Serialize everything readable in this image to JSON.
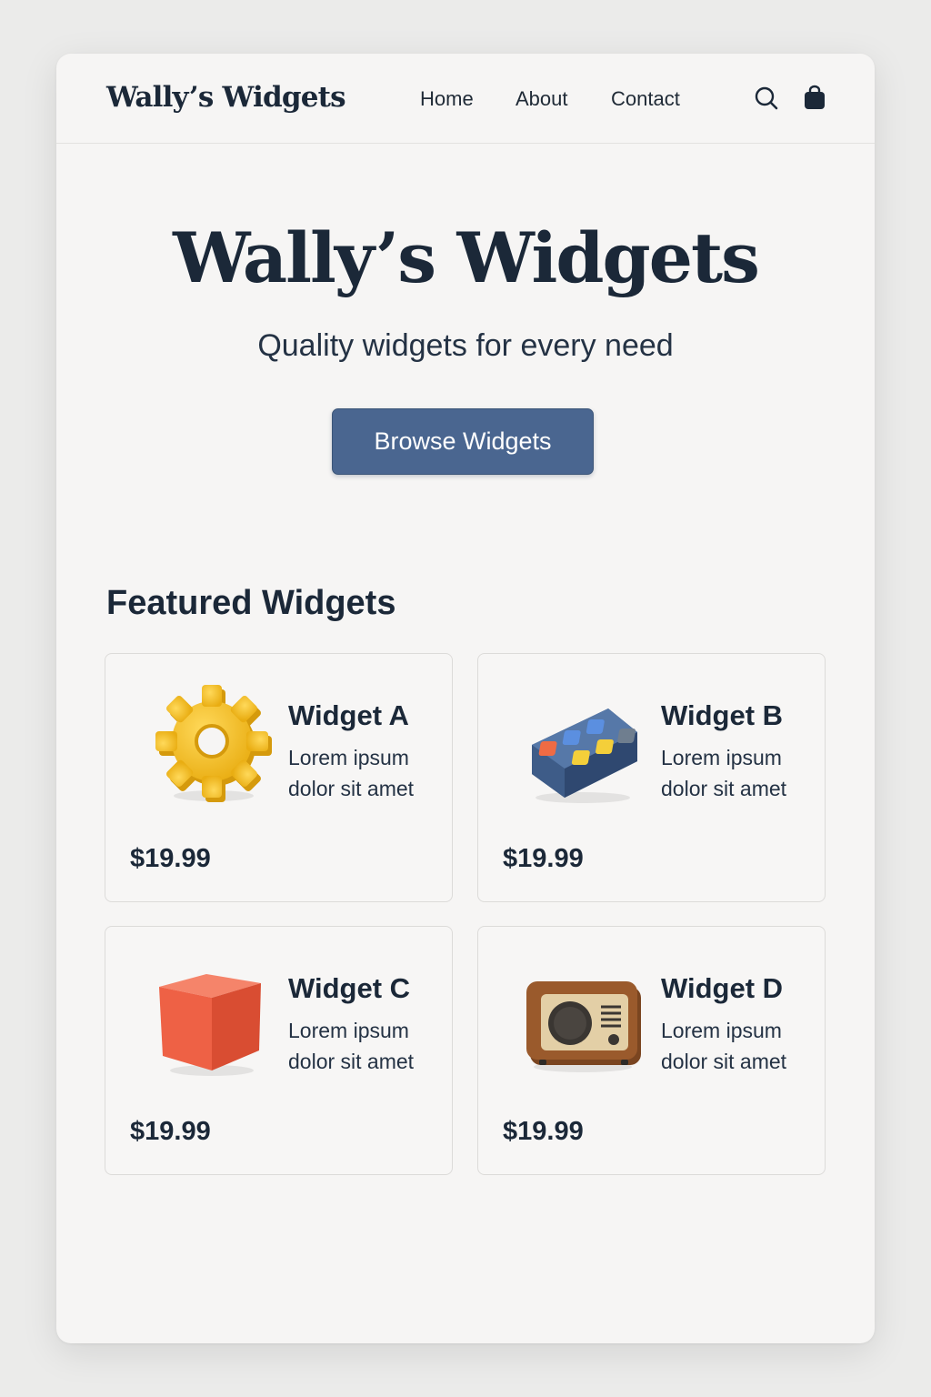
{
  "header": {
    "brand": "Wally’s Widgets",
    "nav": [
      {
        "label": "Home"
      },
      {
        "label": "About"
      },
      {
        "label": "Contact"
      }
    ],
    "icons": [
      "search-icon",
      "shopping-bag-icon"
    ]
  },
  "hero": {
    "title": "Wally’s Widgets",
    "subtitle": "Quality widgets for every need",
    "cta_label": "Browse Widgets"
  },
  "featured": {
    "title": "Featured Widgets",
    "items": [
      {
        "name": "Widget A",
        "description": "Lorem ipsum dolor sit amet",
        "price": "$19.99",
        "icon": "gear-icon",
        "color": "#f2bf2f"
      },
      {
        "name": "Widget B",
        "description": "Lorem ipsum dolor sit amet",
        "price": "$19.99",
        "icon": "button-box-icon",
        "color": "#4a6a9a"
      },
      {
        "name": "Widget C",
        "description": "Lorem ipsum dolor sit amet",
        "price": "$19.99",
        "icon": "cube-icon",
        "color": "#ef6346"
      },
      {
        "name": "Widget D",
        "description": "Lorem ipsum dolor sit amet",
        "price": "$19.99",
        "icon": "radio-icon",
        "color": "#9a5a2c"
      }
    ]
  },
  "colors": {
    "accent": "#4a6690",
    "text": "#1b2838",
    "background": "#f6f5f4"
  }
}
